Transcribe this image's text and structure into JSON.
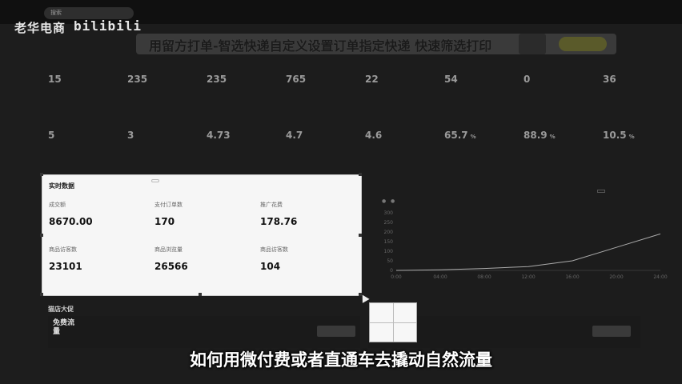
{
  "watermark": {
    "brand": "老华电商",
    "logo": "bilibili"
  },
  "topbar": {
    "search_placeholder": "搜索",
    "nav": [
      "",
      "",
      "",
      "",
      ""
    ]
  },
  "sidebar": {
    "items": [
      "",
      "",
      "",
      "",
      "",
      "",
      "",
      "",
      "",
      ""
    ]
  },
  "banner": {
    "text": "用留方打单-智选快递自定义设置订单指定快递 快速筛选打印",
    "button": ""
  },
  "metrics_row1": [
    {
      "label": "",
      "value": "15",
      "sub": ""
    },
    {
      "label": "",
      "value": "235",
      "sub": ""
    },
    {
      "label": "",
      "value": "235",
      "sub": ""
    },
    {
      "label": "",
      "value": "765",
      "sub": ""
    },
    {
      "label": "",
      "value": "22",
      "sub": ""
    },
    {
      "label": "",
      "value": "54",
      "sub": ""
    },
    {
      "label": "",
      "value": "0",
      "sub": ""
    },
    {
      "label": "",
      "value": "36",
      "sub": ""
    }
  ],
  "metrics_row2": [
    {
      "label": "",
      "value": "5",
      "unit": "",
      "sub": ""
    },
    {
      "label": "",
      "value": "3",
      "unit": "",
      "sub": ""
    },
    {
      "label": "",
      "value": "4.73",
      "unit": "",
      "sub": ""
    },
    {
      "label": "",
      "value": "4.7",
      "unit": "",
      "sub": ""
    },
    {
      "label": "",
      "value": "4.6",
      "unit": "",
      "sub": ""
    },
    {
      "label": "",
      "value": "65.7",
      "unit": "%",
      "sub": ""
    },
    {
      "label": "",
      "value": "88.9",
      "unit": "%",
      "sub": ""
    },
    {
      "label": "",
      "value": "10.5",
      "unit": "%",
      "sub": ""
    }
  ],
  "realtime": {
    "title": "实时数据",
    "date": "",
    "button": "",
    "metrics": [
      {
        "label": "成交额",
        "value": "8670.00",
        "unit": "",
        "sub": ""
      },
      {
        "label": "支付订单数",
        "value": "170",
        "unit": "",
        "sub": ""
      },
      {
        "label": "推广花费",
        "value": "178.76",
        "unit": "",
        "sub": ""
      },
      {
        "label": "商品访客数",
        "value": "23101",
        "unit": "",
        "sub": ""
      },
      {
        "label": "商品浏览量",
        "value": "26566",
        "unit": "",
        "sub": ""
      },
      {
        "label": "商品访客数",
        "value": "104",
        "unit": "",
        "sub": ""
      }
    ]
  },
  "chart": {
    "title": "",
    "tabs": [
      "",
      "",
      "",
      ""
    ],
    "legend": [
      "",
      ""
    ]
  },
  "chart_data": {
    "type": "line",
    "x": [
      "0:00",
      "4:00",
      "8:00",
      "12:00",
      "16:00",
      "20:00",
      "24:00"
    ],
    "series": [
      {
        "values": [
          0,
          3,
          10,
          20,
          50,
          120,
          190
        ]
      }
    ],
    "yticks": [
      "300",
      "250",
      "200",
      "150",
      "100",
      "50",
      "0"
    ],
    "xticks": [
      "0:00",
      "04:00",
      "08:00",
      "12:00",
      "16:00",
      "20:00",
      "24:00"
    ],
    "ylim": [
      0,
      300
    ],
    "color": "#aaaaaa"
  },
  "section": {
    "title": "猫店大促"
  },
  "promo": {
    "icon_text": "免费流量",
    "text": "",
    "bullets": ""
  },
  "promo2": {
    "text": ""
  },
  "bottom": {
    "text": ""
  },
  "subtitle": "如何用微付费或者直通车去撬动自然流量"
}
